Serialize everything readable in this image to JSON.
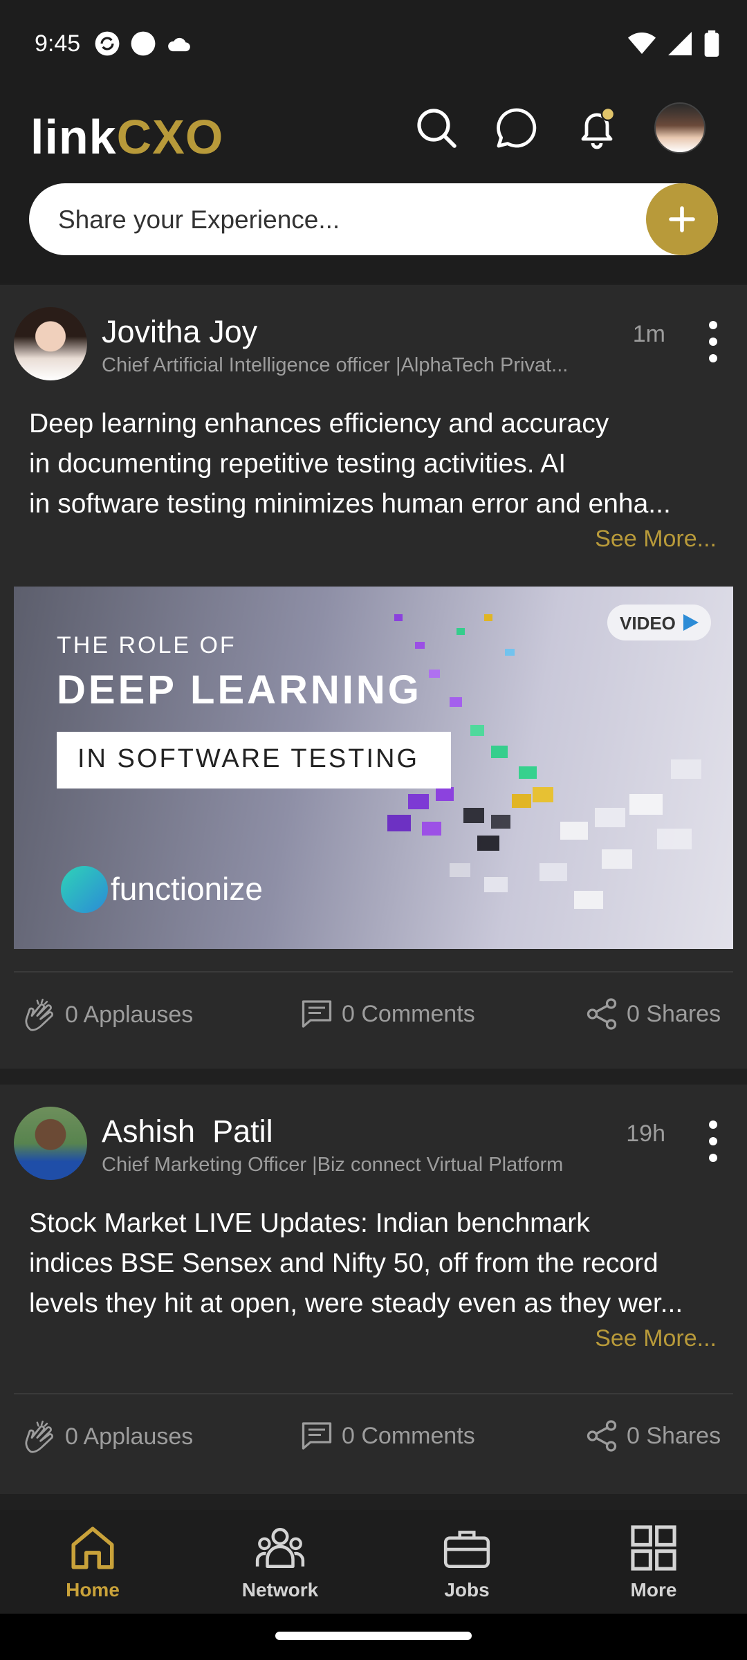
{
  "status_bar": {
    "time": "9:45",
    "left_icons": [
      "sync-icon",
      "circle-icon",
      "cloud-icon"
    ],
    "right_icons": [
      "wifi-icon",
      "signal-icon",
      "battery-icon"
    ]
  },
  "header": {
    "logo_part1": "link",
    "logo_part2": "CXO",
    "icons": [
      "search-icon",
      "chat-icon",
      "bell-icon",
      "profile-avatar"
    ],
    "share_placeholder": "Share your Experience...",
    "accent_color": "#b89a3a"
  },
  "posts": [
    {
      "author": "Jovitha Joy",
      "title": "Chief Artificial Intelligence officer |AlphaTech Privat...",
      "time": "1m",
      "text_lines": [
        "Deep learning enhances efficiency and accuracy",
        "in documenting repetitive testing activities. AI",
        "in software testing minimizes human error and enha..."
      ],
      "see_more": "See More...",
      "image": {
        "line1": "THE ROLE OF",
        "line2": "DEEP LEARNING",
        "line3": "IN SOFTWARE TESTING",
        "brand": "functionize",
        "badge": "VIDEO"
      },
      "applauses": "0 Applauses",
      "comments": "0 Comments",
      "shares": "0 Shares"
    },
    {
      "author": "Ashish  Patil",
      "title": "Chief Marketing Officer |Biz connect Virtual Platform",
      "time": "19h",
      "text_lines": [
        "Stock Market LIVE Updates: Indian benchmark",
        "indices BSE Sensex and Nifty 50, off from the record",
        "levels they hit at open, were steady even as they wer..."
      ],
      "see_more": "See More...",
      "applauses": "0 Applauses",
      "comments": "0 Comments",
      "shares": "0 Shares"
    }
  ],
  "bottom_nav": [
    {
      "label": "Home",
      "icon": "home-icon",
      "active": true
    },
    {
      "label": "Network",
      "icon": "network-icon",
      "active": false
    },
    {
      "label": "Jobs",
      "icon": "briefcase-icon",
      "active": false
    },
    {
      "label": "More",
      "icon": "grid-icon",
      "active": false
    }
  ]
}
